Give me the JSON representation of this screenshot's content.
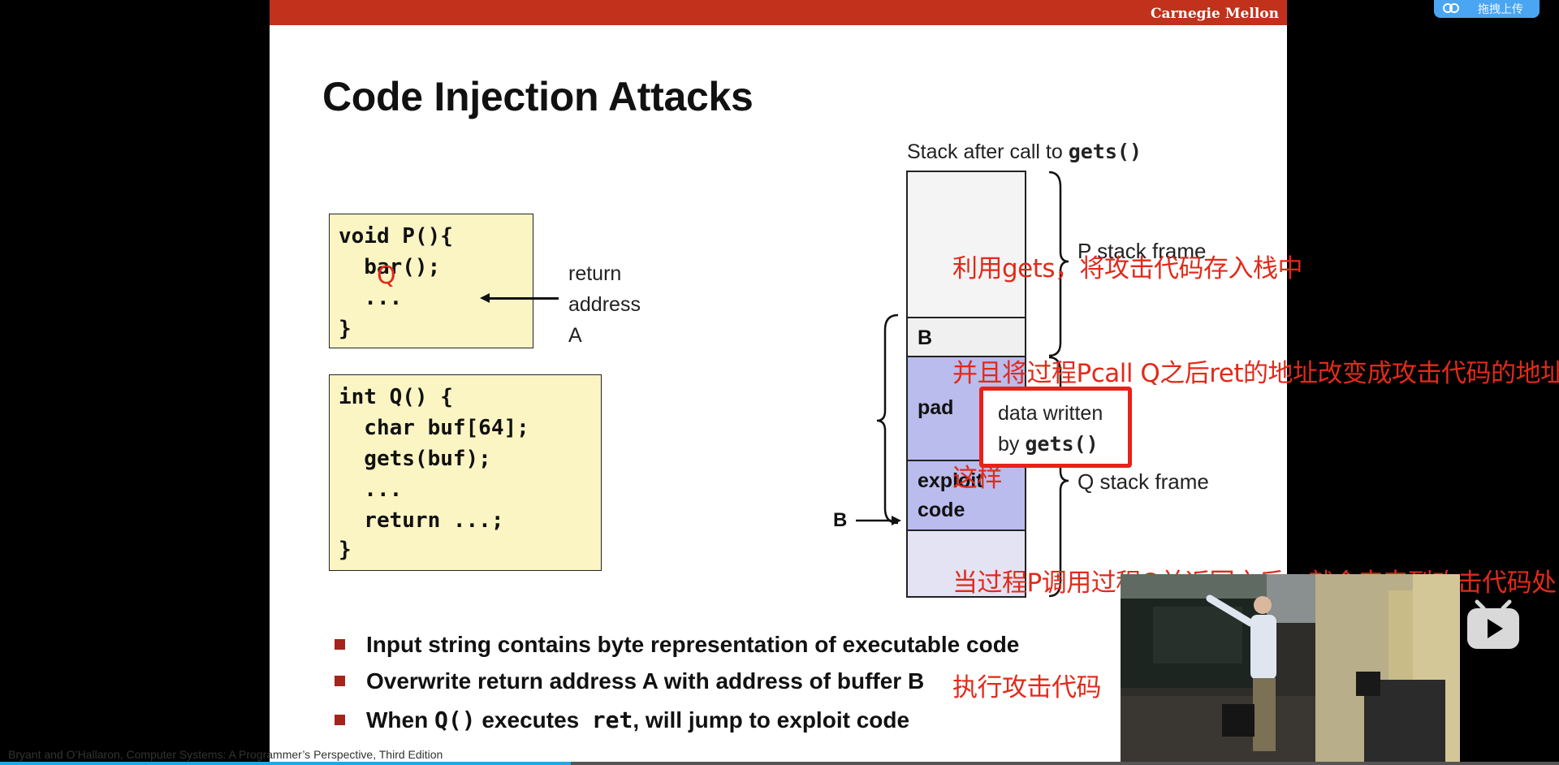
{
  "slide": {
    "header_brand": "Carnegie Mellon",
    "title": "Code Injection Attacks",
    "code_p": [
      "void P(){",
      "  bar();",
      "  ...",
      "}"
    ],
    "code_p_annotation": "Q",
    "return_label": [
      "return",
      "address",
      "A"
    ],
    "code_q": [
      "int Q() {",
      "  char buf[64];",
      "  gets(buf);",
      "  ...",
      "  return ...;",
      "}"
    ],
    "stack_caption_prefix": "Stack after call to ",
    "stack_caption_code": "gets()",
    "stack_cells": [
      "B",
      "pad",
      "exploit",
      "code"
    ],
    "p_frame_label": "P  stack frame",
    "q_frame_label": "Q stack frame",
    "data_written_line1": "data written",
    "data_written_line2_prefix": "by ",
    "data_written_line2_code": "gets()",
    "b_pointer_label": "B",
    "annotation_lines": [
      "利用gets，将攻击代码存入栈中",
      "并且将过程Pcall Q之后ret的地址改变成攻击代码的地址",
      "这样",
      "当过程P调用过程Q并返回之后，就会来来到攻击代码处",
      "执行攻击代码"
    ],
    "bullets": {
      "b1": "Input string contains byte representation of executable code",
      "b2": "Overwrite return address A with address of buffer B",
      "b3_prefix": "When ",
      "b3_code1": "Q()",
      "b3_mid": " executes  ",
      "b3_code2": "ret",
      "b3_suffix": ", will jump to exploit code"
    },
    "footer_credit": "Bryant and O’Hallaron, Computer Systems: A Programmer’s Perspective, Third Edition"
  },
  "player": {
    "upload_label": "拖拽上传",
    "progress_fraction": 0.366
  },
  "colors": {
    "header_red": "#c1311b",
    "code_bg": "#fbf5c3",
    "annotation_red": "#e12a1a",
    "stack_blue": "#b9bcec",
    "stack_light": "#e3e3f4",
    "progress_blue": "#25a5e6"
  }
}
